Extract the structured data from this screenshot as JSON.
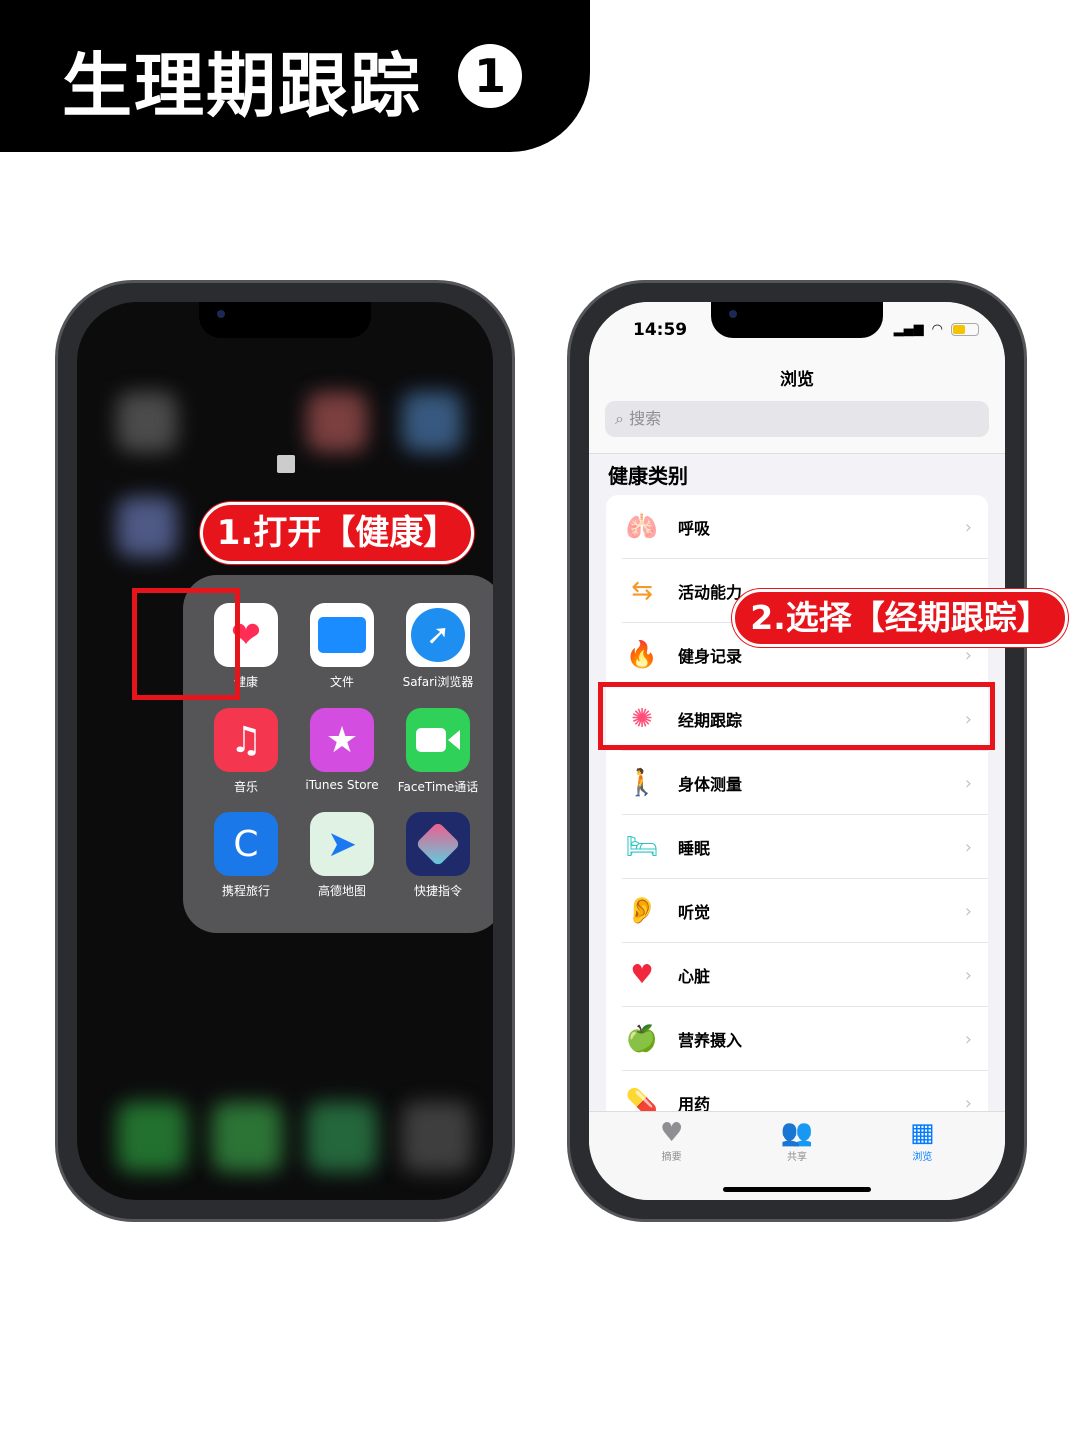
{
  "banner": {
    "title": "生理期跟踪",
    "step": "1"
  },
  "left_phone": {
    "folder_apps": [
      {
        "label": "健康",
        "icon": "health-heart-icon",
        "color": "#ffffff"
      },
      {
        "label": "文件",
        "icon": "files-folder-icon",
        "color": "#1a8cff"
      },
      {
        "label": "Safari浏览器",
        "icon": "safari-compass-icon",
        "color": "#1e8ef0"
      },
      {
        "label": "音乐",
        "icon": "music-note-icon",
        "color": "#f5364f"
      },
      {
        "label": "iTunes Store",
        "icon": "itunes-star-icon",
        "color": "#d34ee0"
      },
      {
        "label": "FaceTime通话",
        "icon": "facetime-camera-icon",
        "color": "#2fd158"
      },
      {
        "label": "携程旅行",
        "icon": "ctrip-dolphin-icon",
        "color": "#1a78e8"
      },
      {
        "label": "高德地图",
        "icon": "amap-plane-icon",
        "color": "#dff2e4"
      },
      {
        "label": "快捷指令",
        "icon": "shortcuts-icon",
        "color": "#1e2a6a"
      }
    ]
  },
  "callouts": {
    "step1": "1.打开【健康】",
    "step2": "2.选择【经期跟踪】"
  },
  "right_phone": {
    "status": {
      "time": "14:59"
    },
    "nav_title": "浏览",
    "search_placeholder": "搜索",
    "section_title": "健康类别",
    "categories": [
      {
        "label": "呼吸",
        "icon": "lungs-icon",
        "color": "#3a8ee6"
      },
      {
        "label": "活动能力",
        "icon": "arrows-icon",
        "color": "#f39a2b"
      },
      {
        "label": "健身记录",
        "icon": "flame-icon",
        "color": "#f25c1d"
      },
      {
        "label": "经期跟踪",
        "icon": "cycle-dots-icon",
        "color": "#ff4f7a"
      },
      {
        "label": "身体测量",
        "icon": "figure-icon",
        "color": "#a256e0"
      },
      {
        "label": "睡眠",
        "icon": "bed-icon",
        "color": "#2cc5c0"
      },
      {
        "label": "听觉",
        "icon": "ear-icon",
        "color": "#2f7fe0"
      },
      {
        "label": "心脏",
        "icon": "heart-icon",
        "color": "#f2273d"
      },
      {
        "label": "营养摄入",
        "icon": "apple-icon",
        "color": "#4cc144"
      },
      {
        "label": "用药",
        "icon": "pills-icon",
        "color": "#3aa5e0"
      }
    ],
    "tabs": [
      {
        "label": "摘要",
        "icon": "heart-icon"
      },
      {
        "label": "共享",
        "icon": "people-icon"
      },
      {
        "label": "浏览",
        "icon": "grid-icon",
        "active": true
      }
    ],
    "accent": "#007aff"
  },
  "highlight_color": "#e8141c"
}
